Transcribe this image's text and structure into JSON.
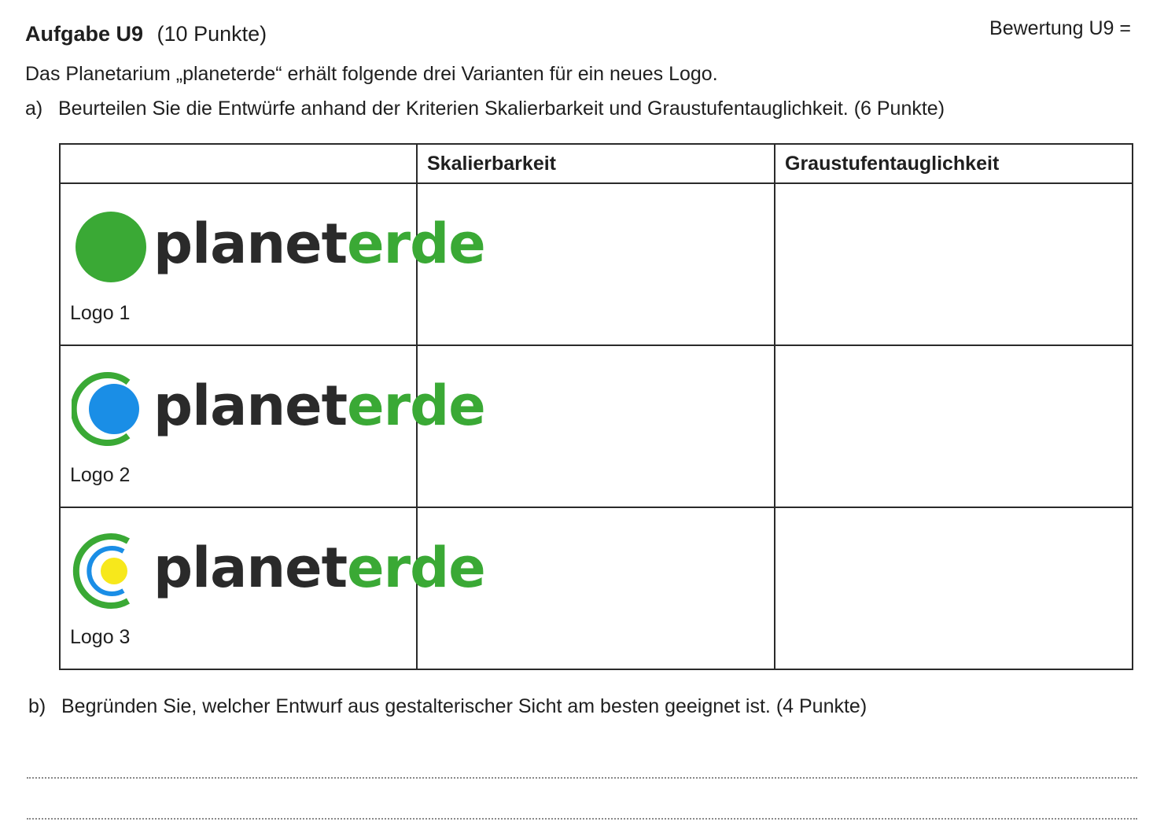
{
  "header": {
    "task_name": "Aufgabe U9",
    "task_points": "(10 Punkte)",
    "rating_label": "Bewertung U9 ="
  },
  "intro": "Das Planetarium „planeterde“ erhält folgende drei Varianten für ein neues Logo.",
  "part_a": {
    "letter": "a)",
    "text": "Beurteilen Sie die Entwürfe anhand der Kriterien Skalierbarkeit und Graustufentauglichkeit. (6 Punkte)"
  },
  "table": {
    "headers": [
      "",
      "Skalierbarkeit",
      "Graustufentauglichkeit"
    ],
    "rows": [
      {
        "wordmark_dark": "planet",
        "wordmark_green": "erde",
        "caption": "Logo 1",
        "skalierbarkeit": "",
        "graustufen": ""
      },
      {
        "wordmark_dark": "planet",
        "wordmark_green": "erde",
        "caption": "Logo 2",
        "skalierbarkeit": "",
        "graustufen": ""
      },
      {
        "wordmark_dark": "planet",
        "wordmark_green": "erde",
        "caption": "Logo 3",
        "skalierbarkeit": "",
        "graustufen": ""
      }
    ]
  },
  "part_b": {
    "letter": "b)",
    "text": "Begründen Sie, welcher Entwurf aus gestalterischer Sicht am besten geeignet ist. (4 Punkte)"
  },
  "colors": {
    "logo_green": "#3aa935",
    "logo_blue": "#1a8ee6",
    "logo_yellow": "#f7e81b",
    "wordmark_dark": "#2a2a2a"
  },
  "icons": [
    "logo-1-green-circle-icon",
    "logo-2-blue-circle-green-arc-icon",
    "logo-3-yellow-circle-blue-green-arcs-icon"
  ]
}
